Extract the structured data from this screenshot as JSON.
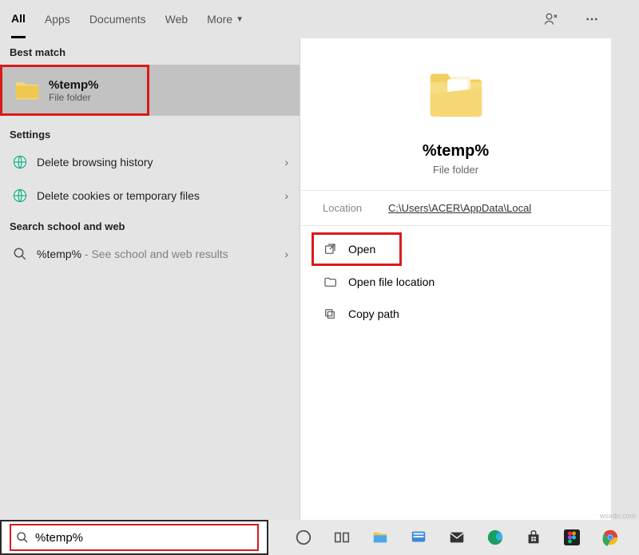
{
  "tabs": {
    "all": "All",
    "apps": "Apps",
    "documents": "Documents",
    "web": "Web",
    "more": "More"
  },
  "sections": {
    "best_match": "Best match",
    "settings": "Settings",
    "school_web": "Search school and web"
  },
  "best_match": {
    "title": "%temp%",
    "subtitle": "File folder"
  },
  "settings_items": [
    {
      "label": "Delete browsing history"
    },
    {
      "label": "Delete cookies or temporary files"
    }
  ],
  "web_item": {
    "query": "%temp%",
    "hint": " - See school and web results"
  },
  "preview": {
    "title": "%temp%",
    "subtitle": "File folder",
    "location_key": "Location",
    "location_val": "C:\\Users\\ACER\\AppData\\Local"
  },
  "actions": {
    "open": "Open",
    "open_location": "Open file location",
    "copy_path": "Copy path"
  },
  "search_value": "%temp%",
  "watermark": "wsxdn.com"
}
